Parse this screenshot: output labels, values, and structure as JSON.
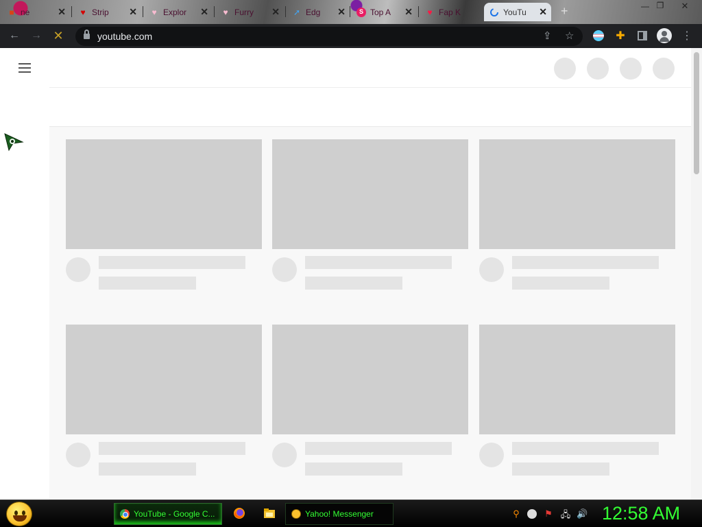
{
  "browser": {
    "tabs": [
      {
        "title": "ne",
        "favicon": "folder-icon"
      },
      {
        "title": "Strip",
        "favicon": "heart-icon"
      },
      {
        "title": "Explor",
        "favicon": "heart-icon"
      },
      {
        "title": "Furry",
        "favicon": "heart-icon"
      },
      {
        "title": "Edg",
        "favicon": "arrow-icon"
      },
      {
        "title": "Top A",
        "favicon": "s-icon"
      },
      {
        "title": "Fap K",
        "favicon": "heart-icon"
      },
      {
        "title": "YouTu",
        "favicon": "loading-spinner-icon",
        "active": true
      }
    ],
    "new_tab_label": "+",
    "url": "youtube.com"
  },
  "taskbar": {
    "tasks": [
      {
        "label": "YouTube - Google C...",
        "active": true
      },
      {
        "label": "Yahoo! Messenger",
        "active": false
      }
    ],
    "clock": "12:58 AM"
  },
  "colors": {
    "taskbar_text": "#33ff33",
    "placeholder_thumb": "#cfcfcf",
    "placeholder_bar": "#e4e4e4"
  }
}
